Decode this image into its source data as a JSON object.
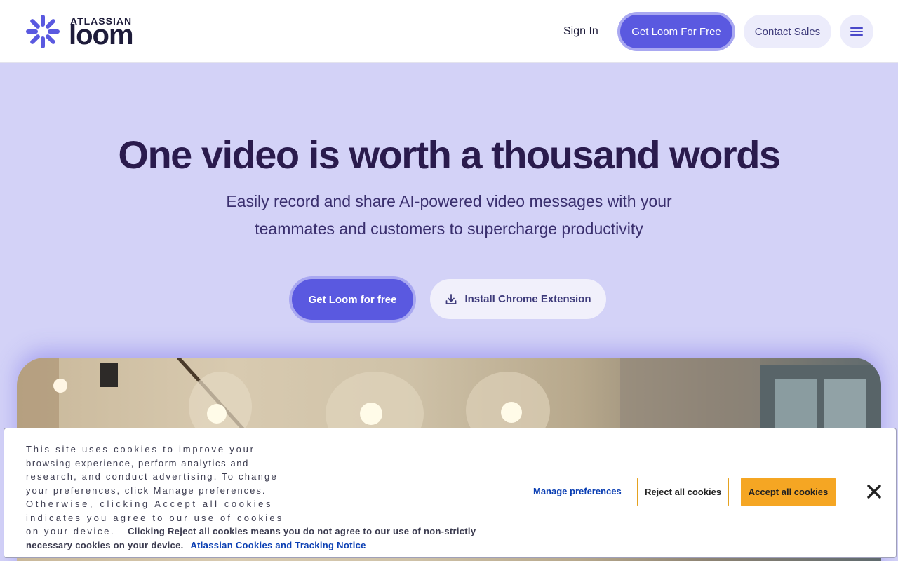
{
  "header": {
    "logo_top": "ATLASSIAN",
    "logo_brand": "loom",
    "sign_in": "Sign In",
    "cta": "Get Loom For Free",
    "contact": "Contact Sales"
  },
  "hero": {
    "title": "One video is worth a thousand words",
    "subtitle_line1": "Easily record and share AI-powered video messages with your",
    "subtitle_line2": "teammates and customers to supercharge productivity",
    "primary_button": "Get Loom for free",
    "secondary_button": "Install Chrome Extension"
  },
  "cookie": {
    "text_line1": "This site uses cookies to improve your",
    "text_line2": "browsing experience, perform analytics and",
    "text_line3": "research, and conduct advertising. To change",
    "text_line4": "your preferences, click Manage preferences.",
    "text_line5": "Otherwise, clicking Accept all cookies",
    "text_line6": "indicates you agree to our use of cookies",
    "text_line7": "on your device.",
    "reject_note": "Clicking Reject all cookies means you do not agree to our use of non-strictly necessary cookies on your device.",
    "link": "Atlassian Cookies and Tracking Notice",
    "manage": "Manage preferences",
    "reject": "Reject all cookies",
    "accept": "Accept all cookies"
  },
  "icons": {
    "logo": "loom-burst-icon",
    "menu": "hamburger-menu-icon",
    "download": "download-icon",
    "close": "close-x-icon"
  },
  "colors": {
    "brand": "#5a59e0",
    "hero_bg": "#d3d2f7",
    "accept": "#f5a623",
    "link": "#0b3fb3"
  }
}
